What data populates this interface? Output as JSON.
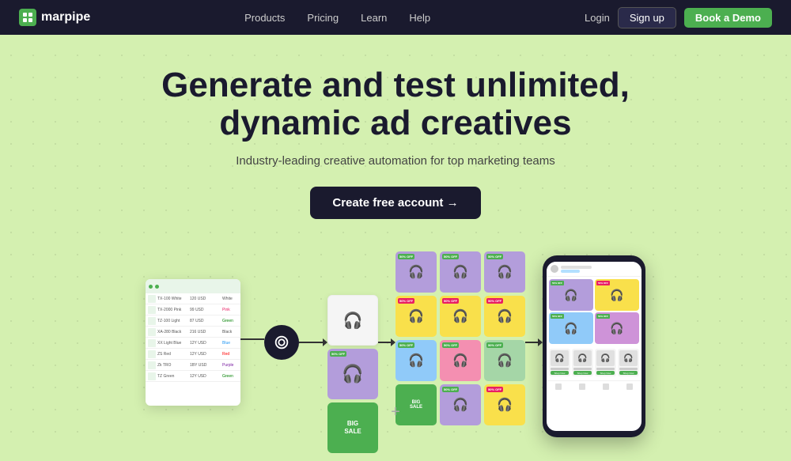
{
  "nav": {
    "logo_text": "marpipe",
    "links": [
      "Products",
      "Pricing",
      "Learn",
      "Help"
    ],
    "login_label": "Login",
    "signup_label": "Sign up",
    "demo_label": "Book a Demo"
  },
  "hero": {
    "title_line1": "Generate and test unlimited,",
    "title_line2": "dynamic ad creatives",
    "subtitle": "Industry-leading creative automation for top marketing teams",
    "cta_label": "Create free account →"
  },
  "illustration": {
    "badge_50off": "50% OFF",
    "badge_bigsale": "BIG SALE"
  }
}
